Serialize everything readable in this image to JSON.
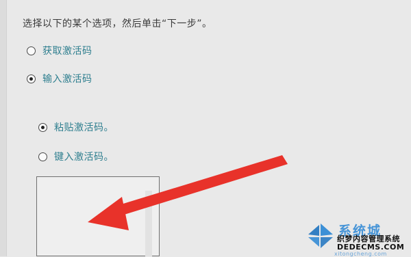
{
  "instruction": "选择以下的某个选项，然后单击“下一步”。",
  "options": {
    "get_key": {
      "label": "获取激活码",
      "checked": false
    },
    "enter_key": {
      "label": "输入激活码",
      "checked": true
    }
  },
  "sub_options": {
    "paste_key": {
      "label": "粘贴激活码。",
      "checked": true
    },
    "type_key": {
      "label": "键入激活码。",
      "checked": false
    }
  },
  "key_box": {
    "value": ""
  },
  "colors": {
    "option_text": "#2f7f8f",
    "arrow": "#e8322a",
    "watermark_blue": "#2a86d4"
  },
  "watermark": {
    "brand": "系统城",
    "line1": "织梦内容管理系统",
    "line2": "DEDECMS.COM",
    "domain": "xitongcheng.com"
  }
}
